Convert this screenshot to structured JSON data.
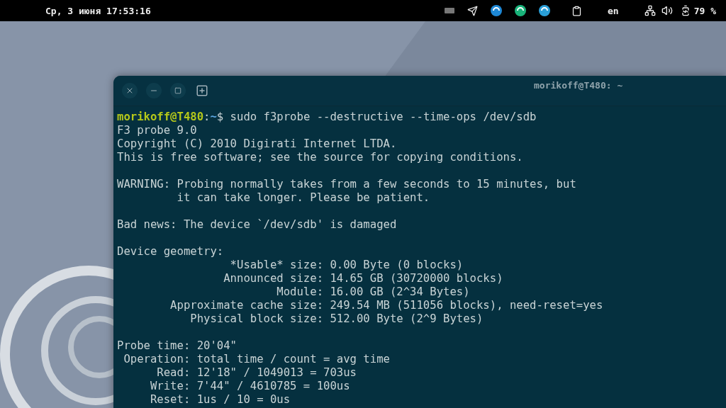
{
  "top_bar": {
    "clock": "Ср, 3 июня 17:53:16",
    "keyboard_layout": "en",
    "battery": "79 %"
  },
  "terminal": {
    "title": "morikoff@T480: ~",
    "prompt": {
      "user": "morikoff@T480",
      "colon": ":",
      "cwd": "~",
      "symbol": "$",
      "command": " sudo f3probe --destructive --time-ops /dev/sdb"
    },
    "blocks": [
      [
        "F3 probe 9.0",
        "Copyright (C) 2010 Digirati Internet LTDA.",
        "This is free software; see the source for copying conditions."
      ],
      [
        "WARNING: Probing normally takes from a few seconds to 15 minutes, but",
        "         it can take longer. Please be patient."
      ],
      [
        "Bad news: The device `/dev/sdb' is damaged"
      ],
      [
        "Device geometry:",
        "                 *Usable* size: 0.00 Byte (0 blocks)",
        "                Announced size: 14.65 GB (30720000 blocks)",
        "                        Module: 16.00 GB (2^34 Bytes)",
        "        Approximate cache size: 249.54 MB (511056 blocks), need-reset=yes",
        "           Physical block size: 512.00 Byte (2^9 Bytes)"
      ],
      [
        "Probe time: 20'04\"",
        " Operation: total time / count = avg time",
        "      Read: 12'18\" / 1049013 = 703us",
        "     Write: 7'44\" / 4610785 = 100us",
        "     Reset: 1us / 10 = 0us"
      ]
    ]
  }
}
